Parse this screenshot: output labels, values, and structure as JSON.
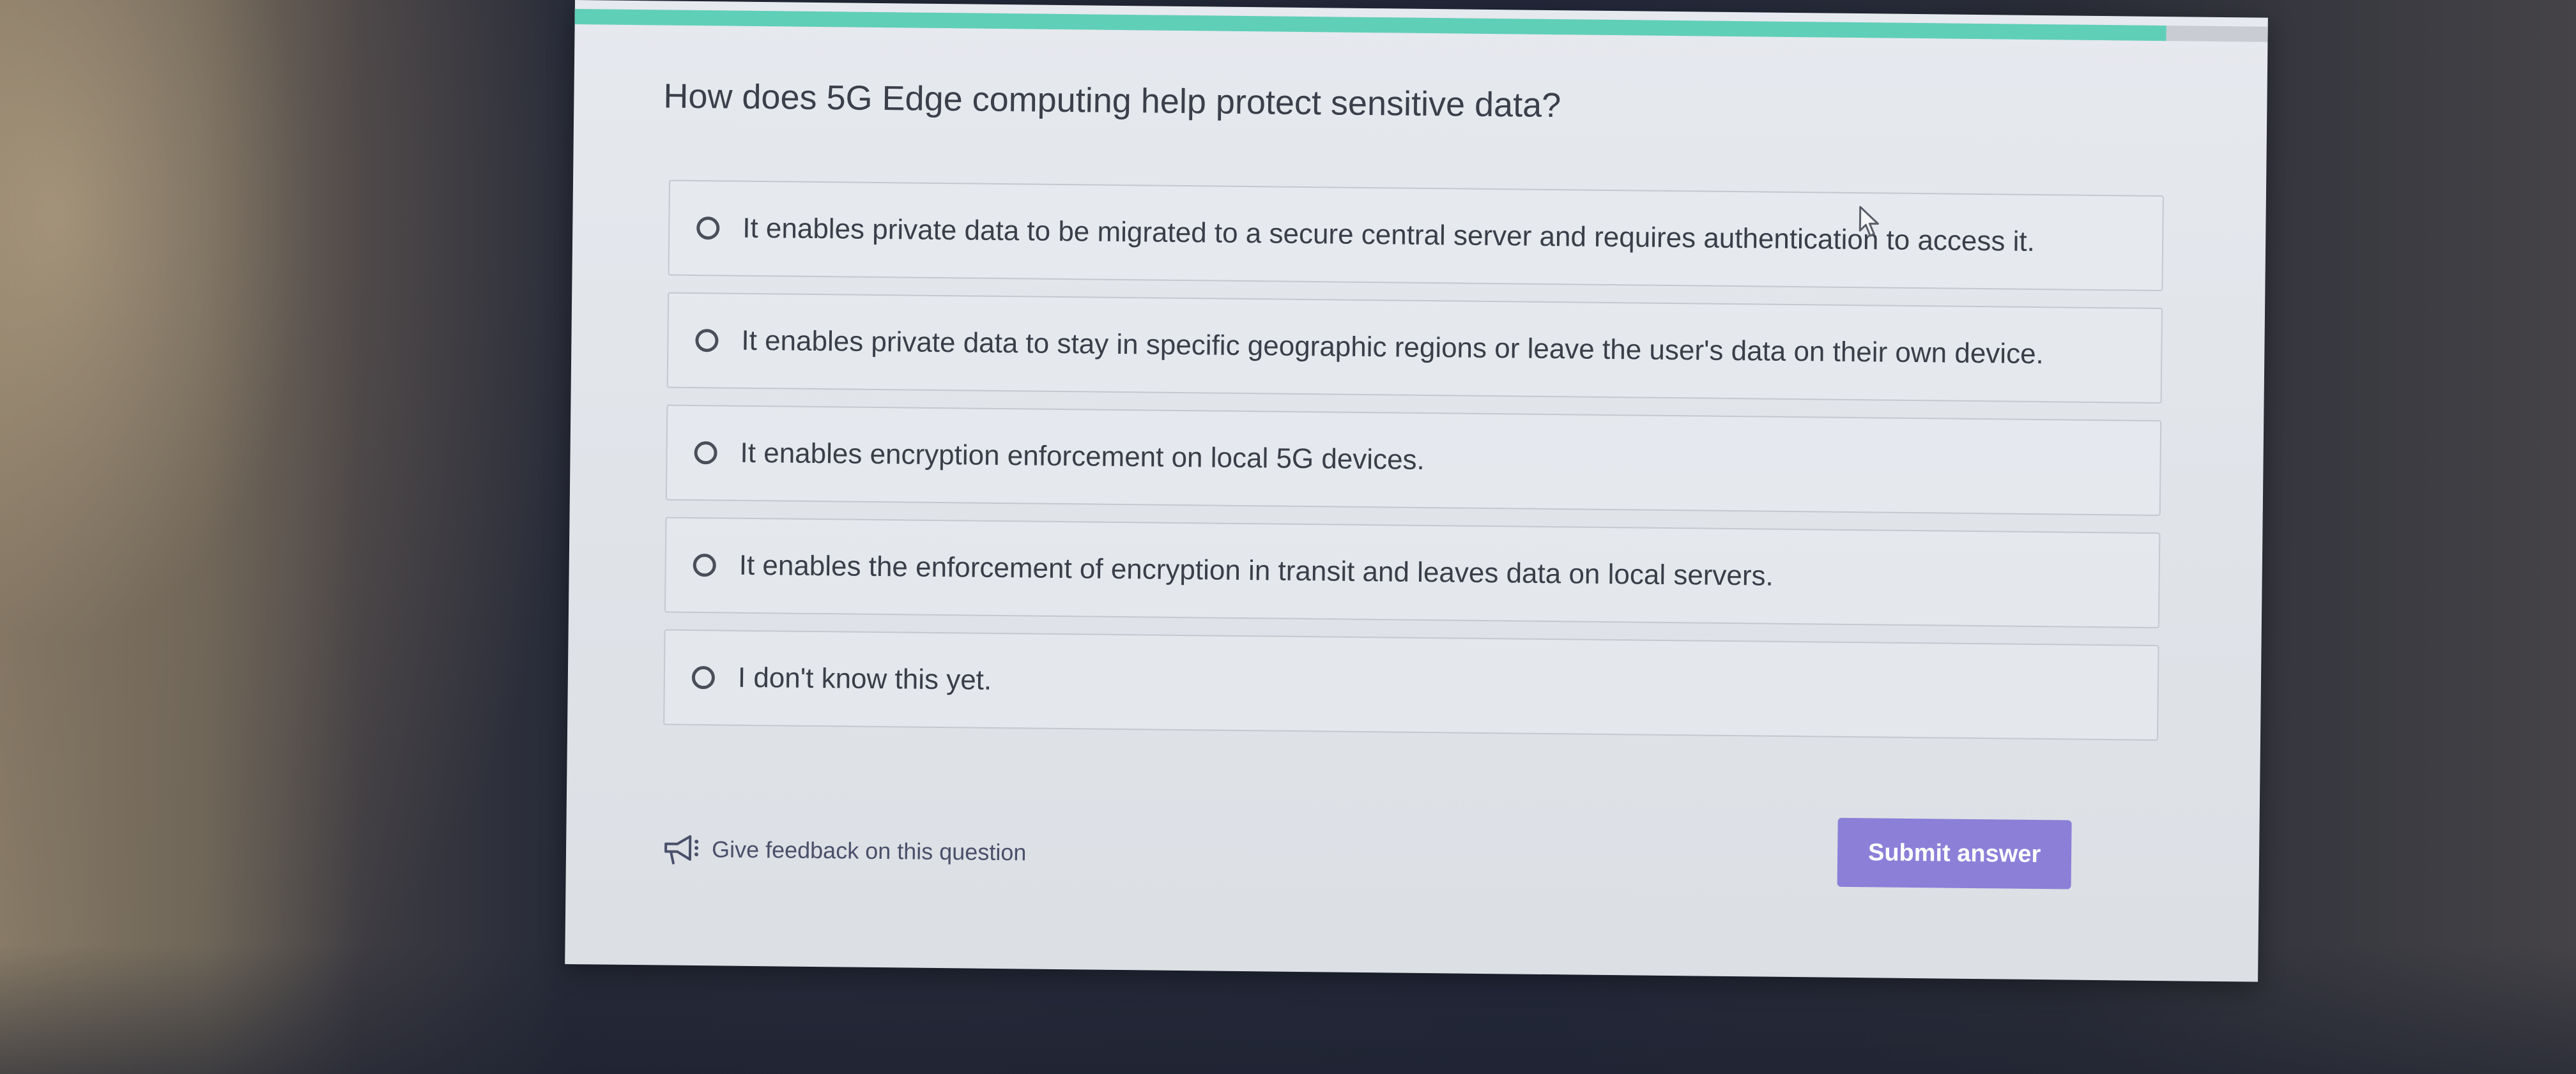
{
  "progress": {
    "fraction": 0.94,
    "fill_color": "#5fcfb8"
  },
  "question": {
    "text": "How does 5G Edge computing help protect sensitive data?"
  },
  "options": [
    {
      "label": "It enables private data to be migrated to a secure central server and requires authentication to access it.",
      "selected": false
    },
    {
      "label": "It enables private data to stay in specific geographic regions or leave the user's data on their own device.",
      "selected": false
    },
    {
      "label": "It enables encryption enforcement on local 5G devices.",
      "selected": false
    },
    {
      "label": "It enables the enforcement of encryption in transit and leaves data on local servers.",
      "selected": false
    },
    {
      "label": "I don't know this yet.",
      "selected": false
    }
  ],
  "feedback": {
    "label": "Give feedback on this question",
    "icon": "megaphone-icon"
  },
  "submit": {
    "label": "Submit answer",
    "color": "#8b7fd8"
  },
  "cursor": {
    "icon": "mouse-pointer-icon"
  }
}
